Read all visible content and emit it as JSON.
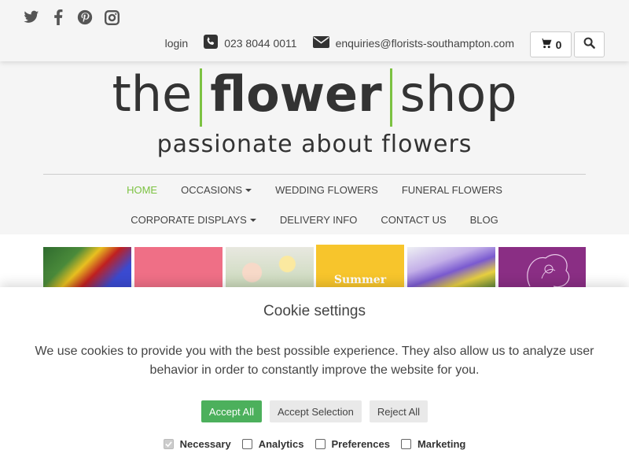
{
  "header": {
    "social": [
      "twitter-icon",
      "facebook-icon",
      "pinterest-icon",
      "instagram-icon"
    ],
    "login_label": "login",
    "phone": "023 8044 0011",
    "email": "enquiries@florists-southampton.com",
    "cart_count": "0"
  },
  "logo": {
    "part1": "the",
    "part2": "flower",
    "part3": "shop",
    "tagline": "passionate about flowers",
    "accent_color": "#7cc242"
  },
  "nav": {
    "row1": [
      {
        "label": "HOME",
        "active": true,
        "dropdown": false
      },
      {
        "label": "OCCASIONS",
        "active": false,
        "dropdown": true
      },
      {
        "label": "WEDDING FLOWERS",
        "active": false,
        "dropdown": false
      },
      {
        "label": "FUNERAL FLOWERS",
        "active": false,
        "dropdown": false
      }
    ],
    "row2": [
      {
        "label": "CORPORATE DISPLAYS",
        "active": false,
        "dropdown": true
      },
      {
        "label": "DELIVERY INFO",
        "active": false,
        "dropdown": false
      },
      {
        "label": "CONTACT US",
        "active": false,
        "dropdown": false
      },
      {
        "label": "BLOG",
        "active": false,
        "dropdown": false
      }
    ]
  },
  "strip": {
    "summer_label": "Summer"
  },
  "cookie": {
    "title": "Cookie settings",
    "text": "We use cookies to provide you with the best possible experience. They also allow us to analyze user behavior in order to constantly improve the website for you.",
    "accept_all": "Accept All",
    "accept_selection": "Accept Selection",
    "reject_all": "Reject All",
    "options": [
      {
        "label": "Necessary",
        "checked": true,
        "disabled": true
      },
      {
        "label": "Analytics",
        "checked": false,
        "disabled": false
      },
      {
        "label": "Preferences",
        "checked": false,
        "disabled": false
      },
      {
        "label": "Marketing",
        "checked": false,
        "disabled": false
      }
    ],
    "accept_color": "#4cb05c"
  }
}
